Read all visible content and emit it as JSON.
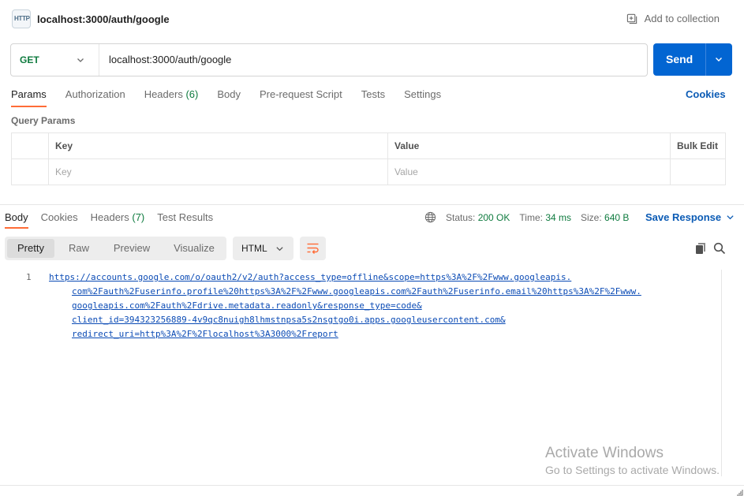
{
  "title_bar": {
    "protocol_icon": "http-icon",
    "protocol_label": "HTTP",
    "request_name": "localhost:3000/auth/google",
    "add_to_collection": "Add to collection"
  },
  "request": {
    "method": "GET",
    "url": "localhost:3000/auth/google",
    "send_label": "Send"
  },
  "request_tabs": [
    {
      "label": "Params",
      "active": true
    },
    {
      "label": "Authorization"
    },
    {
      "label": "Headers",
      "count": "(6)"
    },
    {
      "label": "Body"
    },
    {
      "label": "Pre-request Script"
    },
    {
      "label": "Tests"
    },
    {
      "label": "Settings"
    }
  ],
  "cookies_link": "Cookies",
  "query_params": {
    "title": "Query Params",
    "headers": {
      "key": "Key",
      "value": "Value",
      "bulk_edit": "Bulk Edit"
    },
    "placeholder": {
      "key": "Key",
      "value": "Value"
    }
  },
  "response_tabs": [
    {
      "label": "Body",
      "active": true
    },
    {
      "label": "Cookies"
    },
    {
      "label": "Headers",
      "count": "(7)"
    },
    {
      "label": "Test Results"
    }
  ],
  "response_meta": {
    "status_label": "Status:",
    "status_value": "200 OK",
    "time_label": "Time:",
    "time_value": "34 ms",
    "size_label": "Size:",
    "size_value": "640 B",
    "save_response": "Save Response"
  },
  "view_modes": [
    "Pretty",
    "Raw",
    "Preview",
    "Visualize"
  ],
  "active_view_mode": "Pretty",
  "format": "HTML",
  "body": {
    "line_number": "1",
    "lines": [
      "https://accounts.google.com/o/oauth2/v2/auth?access_type=offline&scope=https%3A%2F%2Fwww.googleapis.",
      "com%2Fauth%2Fuserinfo.profile%20https%3A%2F%2Fwww.googleapis.com%2Fauth%2Fuserinfo.email%20https%3A%2F%2Fwww.",
      "googleapis.com%2Fauth%2Fdrive.metadata.readonly&response_type=code&",
      "client_id=394323256889-4v9qc8nuigh8lhmstnpsa5s2nsgtgo0i.apps.googleusercontent.com&",
      "redirect_uri=http%3A%2F%2Flocalhost%3A3000%2Freport"
    ]
  },
  "watermark": {
    "line1": "Activate Windows",
    "line2": "Go to Settings to activate Windows."
  },
  "colors": {
    "accent_orange": "#ff6c37",
    "send_blue": "#0265d2",
    "status_green": "#0f7b3f",
    "link_blue": "#0b4bb5"
  }
}
